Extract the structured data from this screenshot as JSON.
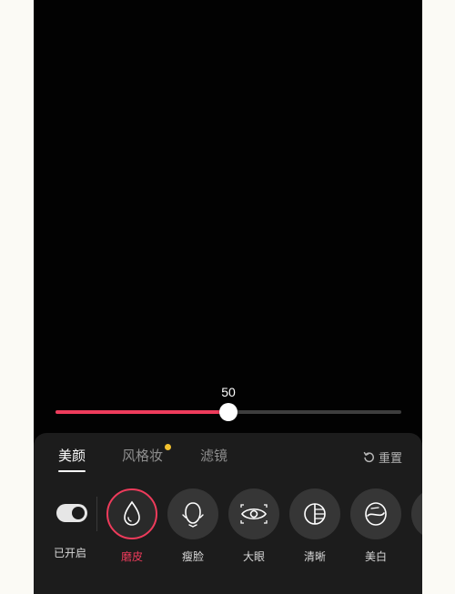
{
  "slider": {
    "value": "50",
    "fraction": 0.5
  },
  "tabs": [
    {
      "label": "美颜",
      "active": true
    },
    {
      "label": "风格妆",
      "active": false,
      "badge": true
    },
    {
      "label": "滤镜",
      "active": false
    }
  ],
  "reset_label": "重置",
  "toggle_label": "已开启",
  "tools": [
    {
      "label": "磨皮",
      "icon": "droplet-icon",
      "active": true
    },
    {
      "label": "瘦脸",
      "icon": "face-icon",
      "active": false
    },
    {
      "label": "大眼",
      "icon": "eye-icon",
      "active": false
    },
    {
      "label": "清晰",
      "icon": "contrast-icon",
      "active": false
    },
    {
      "label": "美白",
      "icon": "whiten-icon",
      "active": false
    }
  ],
  "colors": {
    "accent": "#ee3b5b",
    "badge": "#f2c12e",
    "panel": "#1c1c1c"
  }
}
